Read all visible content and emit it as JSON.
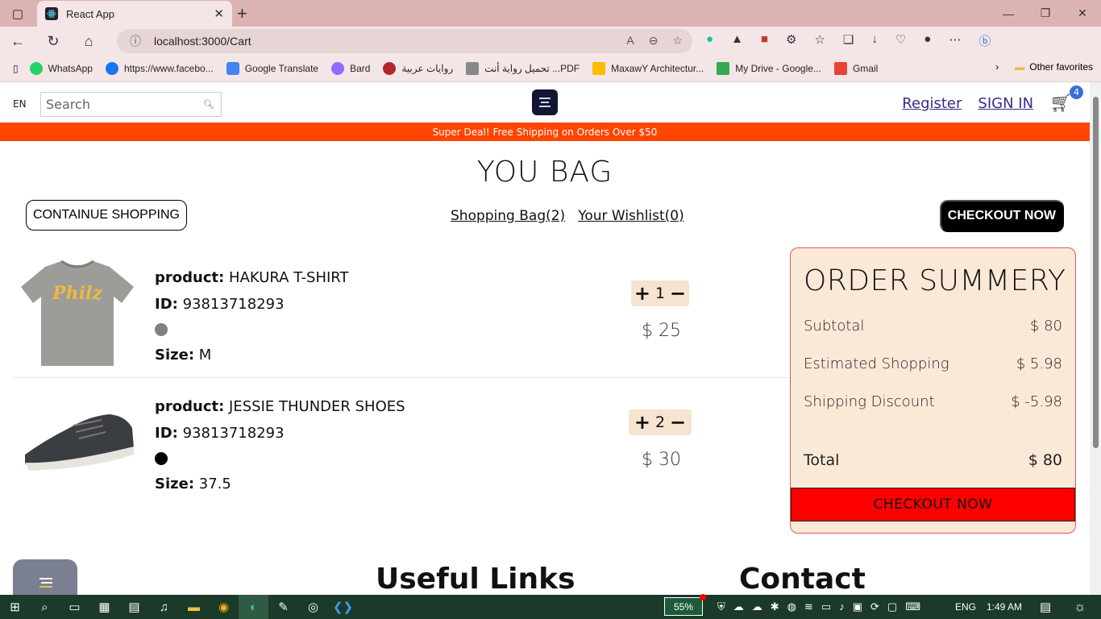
{
  "browser": {
    "tab_title": "React App",
    "url": "localhost:3000/Cart",
    "bookmarks": [
      {
        "label": "WhatsApp",
        "color": "#25d366"
      },
      {
        "label": "https://www.facebo...",
        "color": "#1877f2"
      },
      {
        "label": "Google Translate",
        "color": "#4285f4"
      },
      {
        "label": "Bard",
        "color": "#8e6cff"
      },
      {
        "label": "روايات عربية",
        "color": "#b3262d"
      },
      {
        "label": "تحميل رواية أنت ...PDF",
        "color": "#888888"
      },
      {
        "label": "MaxawY Architectur...",
        "color": "#fbbc04"
      },
      {
        "label": "My Drive - Google...",
        "color": "#34a853"
      },
      {
        "label": "Gmail",
        "color": "#ea4335"
      }
    ],
    "other_favorites": "Other favorites"
  },
  "nav": {
    "lang": "EN",
    "search_placeholder": "Search",
    "register": "Register",
    "signin": "SIGN IN",
    "cart_count": "4"
  },
  "announcement": "Super Deal! Free Shipping on Orders Over $50",
  "page_title": "YOU BAG",
  "actions": {
    "continue": "CONTAINUE SHOPPING",
    "bag": "Shopping Bag(2)",
    "wishlist": "Your Wishlist(0)",
    "checkout_top": "CHECKOUT NOW"
  },
  "labels": {
    "product": "product:",
    "id": "ID:",
    "size": "Size:"
  },
  "products": [
    {
      "name": "HAKURA T-SHIRT",
      "id": "93813718293",
      "color": "#808080",
      "size": "M",
      "qty": "1",
      "price": "$ 25",
      "image": "gray t-shirt"
    },
    {
      "name": "JESSIE THUNDER SHOES",
      "id": "93813718293",
      "color": "#000000",
      "size": "37.5",
      "qty": "2",
      "price": "$ 30",
      "image": "dark sneaker"
    }
  ],
  "summary": {
    "title": "ORDER SUMMERY",
    "rows": [
      {
        "label": "Subtotal",
        "value": "$ 80"
      },
      {
        "label": "Estimated Shopping",
        "value": "$ 5.98"
      },
      {
        "label": "Shipping Discount",
        "value": "$ -5.98"
      },
      {
        "label": "Total",
        "value": "$ 80"
      }
    ],
    "checkout": "CHECKOUT NOW"
  },
  "footer": {
    "useful_links": "Useful Links",
    "contact": "Contact"
  },
  "taskbar": {
    "battery": "55%",
    "lang": "ENG",
    "time": "1:49 AM"
  }
}
